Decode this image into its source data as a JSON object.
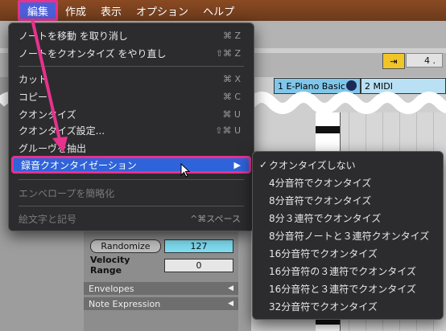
{
  "menubar": {
    "items": [
      {
        "label": "編集",
        "active": true
      },
      {
        "label": "作成",
        "active": false
      },
      {
        "label": "表示",
        "active": false
      },
      {
        "label": "オプション",
        "active": false
      },
      {
        "label": "ヘルプ",
        "active": false
      }
    ]
  },
  "edit_menu": {
    "items": [
      {
        "label": "ノートを移動 を取り消し",
        "shortcut": "⌘ Z"
      },
      {
        "label": "ノートをクオンタイズ をやり直し",
        "shortcut": "⇧⌘ Z"
      },
      {
        "label": "カット",
        "shortcut": "⌘ X"
      },
      {
        "label": "コピー",
        "shortcut": "⌘ C"
      },
      {
        "label": "クオンタイズ",
        "shortcut": "⌘ U"
      },
      {
        "label": "クオンタイズ設定...",
        "shortcut": "⇧⌘ U"
      },
      {
        "label": "グルーヴを抽出",
        "shortcut": ""
      },
      {
        "label": "録音クオンタイゼーション",
        "shortcut": "",
        "highlighted": true
      },
      {
        "label": "エンベロープを簡略化",
        "shortcut": "",
        "disabled": true
      },
      {
        "label": "絵文字と記号",
        "shortcut": "^⌘スペース",
        "disabled": true
      }
    ]
  },
  "quantize_submenu": {
    "items": [
      {
        "label": "クオンタイズしない",
        "checked": true
      },
      {
        "label": "4分音符でクオンタイズ"
      },
      {
        "label": "8分音符でクオンタイズ"
      },
      {
        "label": "8分３連符でクオンタイズ"
      },
      {
        "label": "8分音符ノートと３連符クオンタイズ"
      },
      {
        "label": "16分音符でクオンタイズ"
      },
      {
        "label": "16分音符の３連符でクオンタイズ"
      },
      {
        "label": "16分音符と３連符でクオンタイズ"
      },
      {
        "label": "32分音符でクオンタイズ"
      }
    ]
  },
  "tracks": {
    "track1": "1 E-Piano Basic",
    "track2": "2 MIDI"
  },
  "transport": {
    "value": "4 ."
  },
  "clip_params": {
    "randomize_label": "Randomize",
    "randomize_value": "127",
    "velocity_range_label": "Velocity Range",
    "velocity_range_value": "0",
    "envelopes_label": "Envelopes",
    "note_expression_label": "Note Expression"
  },
  "colors": {
    "highlight": "#2f63d9",
    "annotation": "#e6328c",
    "track_clip": "#7fc6ea"
  }
}
